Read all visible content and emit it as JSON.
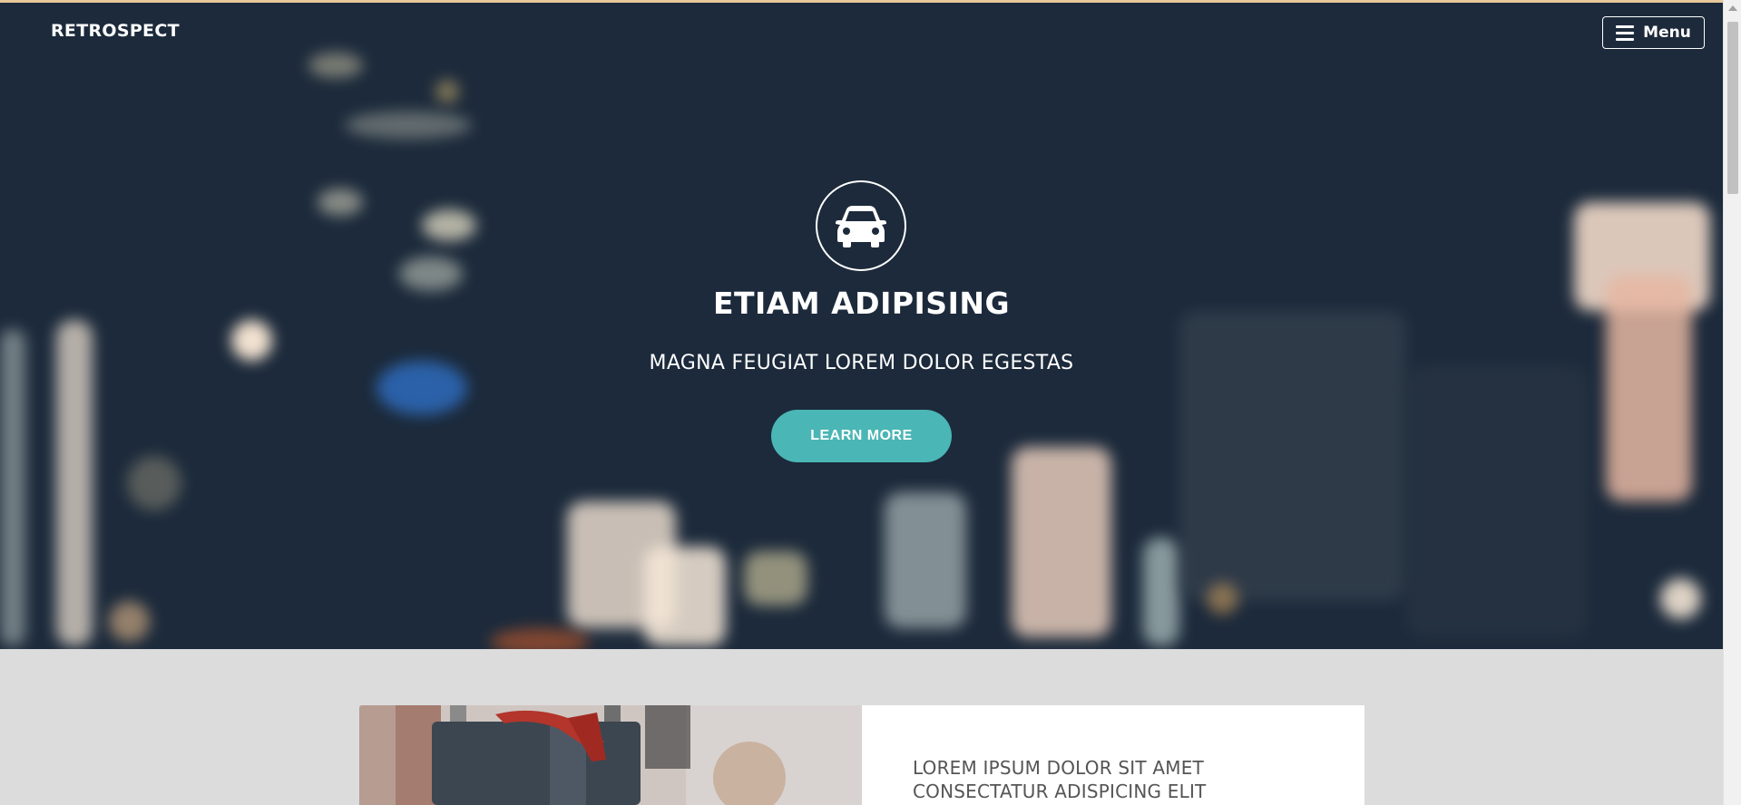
{
  "header": {
    "brand": "RETROSPECT",
    "menu_label": "Menu",
    "menu_icon": "hamburger-icon"
  },
  "hero": {
    "emblem_icon": "car-icon",
    "title": "ETIAM ADIPISING",
    "subtitle": "MAGNA FEUGIAT LOREM DOLOR EGESTAS",
    "cta_label": "LEARN MORE"
  },
  "feature": {
    "title": "LOREM IPSUM DOLOR SIT AMET CONSECTATUR ADISPICING ELIT"
  },
  "colors": {
    "accent": "#4ab6b5",
    "hero_bg": "#1c2a3b",
    "section_bg": "#dcdcdc",
    "top_border": "#e8c79a"
  }
}
